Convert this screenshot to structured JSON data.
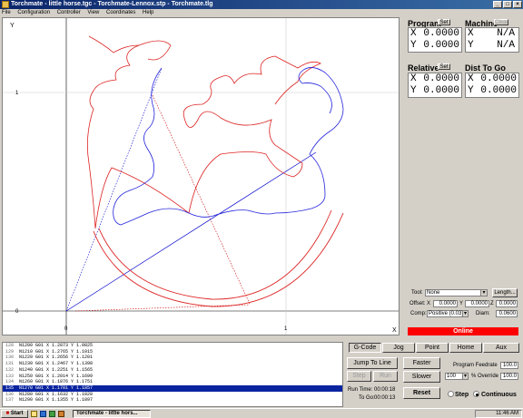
{
  "window": {
    "title": "Torchmate - little horse.tgc - Torchmate-Lennox.stp - Torchmate.tlg",
    "buttons": [
      "_",
      "□",
      "×"
    ]
  },
  "menu": [
    "File",
    "Configuration",
    "Controller",
    "View",
    "Coordinates",
    "Help"
  ],
  "canvas": {
    "y_axis_label": "Y",
    "x_axis_label": "X",
    "tick_y_1": "1",
    "tick_y_0": "0",
    "tick_x_0": "0",
    "tick_x_1": "1"
  },
  "program": {
    "label": "Program",
    "set": "Set",
    "x_label": "X",
    "y_label": "Y",
    "x": "0.0000",
    "y": "0.0000"
  },
  "machine": {
    "label": "Machine",
    "set": "Clear",
    "x_label": "X",
    "y_label": "Y",
    "x": "N/A",
    "y": "N/A"
  },
  "relative": {
    "label": "Relative",
    "set": "Set",
    "x_label": "X",
    "y_label": "Y",
    "x": "0.0000",
    "y": "0.0000"
  },
  "dist_to_go": {
    "label": "Dist To Go",
    "x_label": "X",
    "y_label": "Y",
    "x": "0.0000",
    "y": "0.0000"
  },
  "tool": {
    "label": "Tool:",
    "value": "None",
    "length_button": "Length..."
  },
  "offset": {
    "label": "Offset:",
    "x_label": "X",
    "x": "0.0000",
    "y_label": "Y",
    "y": "0.0000",
    "z_label": "Z",
    "z": "0.0000"
  },
  "comp": {
    "label": "Comp:",
    "value": "Positive (0.03)",
    "diam_label": "Diam:",
    "diam": "0.0600"
  },
  "status": {
    "online": "Online",
    "color": "#ff0000"
  },
  "gcode_lines": [
    {
      "n": "128",
      "text": "N1200 G01 X 1.2873 Y 1.0825"
    },
    {
      "n": "129",
      "text": "N1210 G01 X 1.2765 Y 1.1015"
    },
    {
      "n": "130",
      "text": "N1220 G01 X 1.2656 Y 1.1201"
    },
    {
      "n": "131",
      "text": "N1230 G01 X 1.2467 Y 1.1398"
    },
    {
      "n": "132",
      "text": "N1240 G01 X 1.2251 Y 1.1565"
    },
    {
      "n": "133",
      "text": "N1250 G01 X 1.2014 Y 1.1699"
    },
    {
      "n": "134",
      "text": "N1260 G01 X 1.1876 Y 1.1751"
    },
    {
      "n": "135",
      "text": "N1270 G01 X 1.1781 Y 1.1857"
    },
    {
      "n": "136",
      "text": "N1280 G01 X 1.1632 Y 1.1828"
    },
    {
      "n": "137",
      "text": "N1290 G01 X 1.1355 Y 1.1897"
    }
  ],
  "selected_line_index": 7,
  "tabs": [
    "G-Code",
    "Jog",
    "Point",
    "Home",
    "Aux"
  ],
  "run": {
    "jump": "Jump To Line",
    "step_btn": "Step",
    "run_btn": "Run",
    "faster": "Faster",
    "slower": "Slower",
    "reset": "Reset",
    "run_time_label": "Run Time:",
    "run_time": "00:00:18",
    "to_go_label": "To Go:",
    "to_go": "00:00:13",
    "feedrate_label": "Program Feedrate",
    "feedrate": "100.0",
    "override_value": "100",
    "override_label": "% Override",
    "override_field": "100.0",
    "radio_step": "Step",
    "radio_continuous": "Continuous"
  },
  "taskbar": {
    "start": "Start",
    "task": "Torchmate - little hors...",
    "clock": "11:46 AM"
  }
}
